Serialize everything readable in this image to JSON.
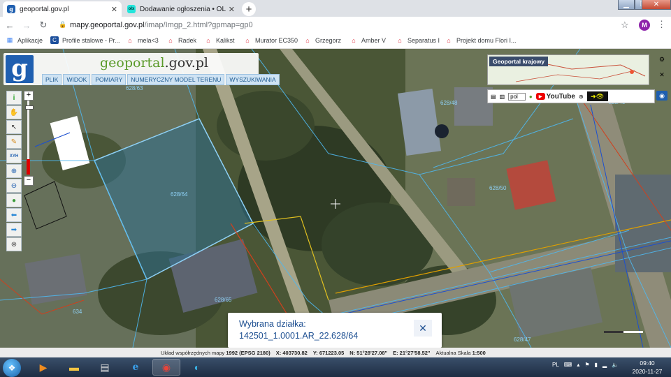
{
  "browser": {
    "tabs": [
      {
        "title": "geoportal.gov.pl",
        "favicon": "geoportal-favicon-icon",
        "active": true
      },
      {
        "title": "Dodawanie ogłoszenia • OLX.pl",
        "favicon": "olx-favicon-icon",
        "active": false
      }
    ],
    "olx_favicon_text": "olx",
    "url_host": "mapy.geoportal.gov.pl",
    "url_path": "/imap/Imgp_2.html?gpmap=gp0",
    "profile_initial": "M",
    "bookmarks": [
      {
        "label": "Aplikacje",
        "icon": "apps-grid-icon"
      },
      {
        "label": "Profile stalowe - Pr...",
        "icon": "c-favicon-icon"
      },
      {
        "label": "mela<3",
        "icon": "house-icon"
      },
      {
        "label": "Radek",
        "icon": "house-icon"
      },
      {
        "label": "Kalikst",
        "icon": "house-icon"
      },
      {
        "label": "Murator EC350",
        "icon": "house-icon"
      },
      {
        "label": "Grzegorz",
        "icon": "house-icon"
      },
      {
        "label": "Amber V",
        "icon": "house-icon"
      },
      {
        "label": "Separatus I",
        "icon": "house-icon"
      },
      {
        "label": "Projekt domu Flori I...",
        "icon": "house-icon"
      }
    ]
  },
  "geoportal": {
    "logo_letter": "g",
    "logo_text_prefix": "geoportal",
    "logo_text_suffix": ".gov.pl",
    "menu": [
      "PLIK",
      "WIDOK",
      "POMIARY",
      "NUMERYCZNY MODEL TERENU",
      "WYSZUKIWANIA"
    ],
    "tools": [
      {
        "name": "info-icon",
        "glyph": "i",
        "color": "#2aa52a"
      },
      {
        "name": "pan-hand-icon",
        "glyph": "✋",
        "color": "#c8873a"
      },
      {
        "name": "select-arrow-icon",
        "glyph": "↖",
        "color": "#333"
      },
      {
        "name": "pencil-icon",
        "glyph": "✎",
        "color": "#d68a1a"
      },
      {
        "name": "xyh-coordinates-icon",
        "glyph": "XYH",
        "color": "#1f5fb0"
      },
      {
        "name": "zoom-in-icon",
        "glyph": "⊕",
        "color": "#1f5fb0"
      },
      {
        "name": "zoom-out-icon",
        "glyph": "⊖",
        "color": "#1f5fb0"
      },
      {
        "name": "globe-icon",
        "glyph": "●",
        "color": "#3c9c3c"
      },
      {
        "name": "back-arrow-icon",
        "glyph": "⬅",
        "color": "#2b89d6"
      },
      {
        "name": "forward-arrow-icon",
        "glyph": "➡",
        "color": "#2b89d6"
      },
      {
        "name": "clear-icon",
        "glyph": "⊗",
        "color": "#555"
      }
    ],
    "zoom_plus": "+",
    "zoom_minus": "−",
    "minimap_label": "Geoportal krajowy",
    "language_value": "pol",
    "youtube_label": "YouTube",
    "map_labels": [
      {
        "text": "628/63"
      },
      {
        "text": "628/64"
      },
      {
        "text": "628/65"
      },
      {
        "text": "628/48"
      },
      {
        "text": "628/50"
      },
      {
        "text": "628/47"
      },
      {
        "text": "628/45"
      },
      {
        "text": "634"
      }
    ],
    "popup": {
      "title": "Wybrana działka:",
      "parcel_id": "142501_1.0001.AR_22.628/64",
      "close_glyph": "✕"
    },
    "status": {
      "coord_system_label": "Układ współrzędnych mapy",
      "coord_system_value": "1992 (EPSG 2180)",
      "x": "X: 403730.82",
      "y": "Y: 671223.05",
      "n": "N: 51°28'27.08\"",
      "e": "E: 21°27'58.52\"",
      "scale_label": "Aktualna Skala",
      "scale_value": "1:500"
    }
  },
  "taskbar": {
    "apps": [
      {
        "name": "media-player-icon",
        "glyph": "▶",
        "color": "#f08c1e"
      },
      {
        "name": "file-explorer-icon",
        "glyph": "▬",
        "color": "#f4c542"
      },
      {
        "name": "notepad-icon",
        "glyph": "▤",
        "color": "#ddd"
      },
      {
        "name": "internet-explorer-icon",
        "glyph": "e",
        "color": "#3a9ee8"
      },
      {
        "name": "chrome-icon",
        "glyph": "◉",
        "color": "#e8443a"
      },
      {
        "name": "edge-icon",
        "glyph": "◐",
        "color": "#38b4e8"
      }
    ],
    "language": "PL",
    "time": "09:40",
    "date": "2020-11-27"
  }
}
